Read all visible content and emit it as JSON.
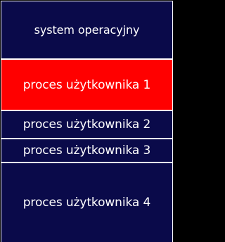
{
  "memory_blocks": [
    {
      "label": "system operacyjny",
      "color": "#0a0a4a"
    },
    {
      "label": "proces użytkownika 1",
      "color": "#ff0000"
    },
    {
      "label": "proces użytkownika 2",
      "color": "#0a0a4a"
    },
    {
      "label": "proces użytkownika 3",
      "color": "#0a0a4a"
    },
    {
      "label": "proces użytkownika 4",
      "color": "#0a0a4a"
    }
  ]
}
